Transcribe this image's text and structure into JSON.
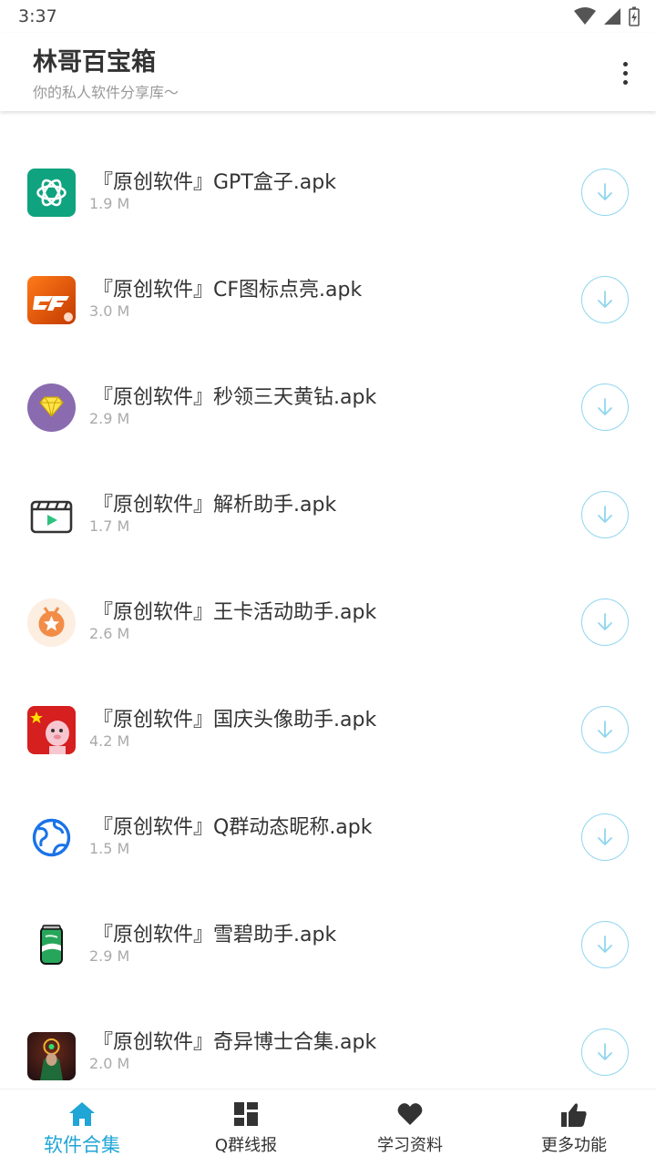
{
  "status": {
    "time": "3:37",
    "icons": [
      "wifi-icon",
      "signal-icon",
      "battery-icon"
    ]
  },
  "header": {
    "title": "林哥百宝箱",
    "subtitle": "你的私人软件分享库～",
    "more_icon": "more-vertical-icon"
  },
  "files": [
    {
      "name": "『原创软件』GPT盒子.apk",
      "size": "1.9 M",
      "icon": "chatgpt-icon"
    },
    {
      "name": "『原创软件』CF图标点亮.apk",
      "size": "3.0 M",
      "icon": "cf-icon"
    },
    {
      "name": "『原创软件』秒领三天黄钻.apk",
      "size": "2.9 M",
      "icon": "diamond-icon"
    },
    {
      "name": "『原创软件』解析助手.apk",
      "size": "1.7 M",
      "icon": "clapperboard-icon"
    },
    {
      "name": "『原创软件』王卡活动助手.apk",
      "size": "2.6 M",
      "icon": "medal-icon"
    },
    {
      "name": "『原创软件』国庆头像助手.apk",
      "size": "4.2 M",
      "icon": "flag-avatar-icon"
    },
    {
      "name": "『原创软件』Q群动态昵称.apk",
      "size": "1.5 M",
      "icon": "globe-icon"
    },
    {
      "name": "『原创软件』雪碧助手.apk",
      "size": "2.9 M",
      "icon": "soda-can-icon"
    },
    {
      "name": "『原创软件』奇异博士合集.apk",
      "size": "2.0 M",
      "icon": "doctor-strange-icon"
    }
  ],
  "download_icon": "download-icon",
  "nav": [
    {
      "label": "软件合集",
      "icon": "home-icon",
      "active": true
    },
    {
      "label": "Q群线报",
      "icon": "dashboard-icon",
      "active": false
    },
    {
      "label": "学习资料",
      "icon": "heart-icon",
      "active": false
    },
    {
      "label": "更多功能",
      "icon": "thumb-up-icon",
      "active": false
    }
  ],
  "colors": {
    "accent": "#1fa5d6",
    "download_ring": "#8fd6ef",
    "text_primary": "#333333",
    "text_secondary": "#aaaaaa"
  }
}
